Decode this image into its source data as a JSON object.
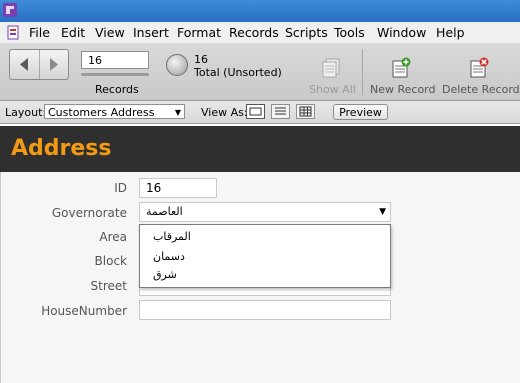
{
  "menu": {
    "items": [
      "File",
      "Edit",
      "View",
      "Insert",
      "Format",
      "Records",
      "Scripts",
      "Tools",
      "Window",
      "Help"
    ]
  },
  "toolbar": {
    "record_number": "16",
    "records_label": "Records",
    "found_count": "16",
    "found_status": "Total (Unsorted)",
    "show_all_label": "Show All",
    "new_record_label": "New Record",
    "delete_record_label": "Delete Record"
  },
  "layoutbar": {
    "layout_label": "Layout:",
    "layout_value": "Customers Address",
    "view_as_label": "View As:",
    "preview_label": "Preview"
  },
  "header": {
    "title": "Address"
  },
  "form": {
    "fields": [
      {
        "label": "ID",
        "value": "16"
      },
      {
        "label": "Governorate",
        "value": "العاصمة"
      },
      {
        "label": "Area",
        "value": ""
      },
      {
        "label": "Block",
        "value": ""
      },
      {
        "label": "Street",
        "value": ""
      },
      {
        "label": "HouseNumber",
        "value": ""
      }
    ]
  },
  "dropdown": {
    "options": [
      "المرقاب",
      "دسمان",
      "شرق"
    ]
  },
  "colors": {
    "header_bg": "#2f2f2f",
    "header_title": "#f39a14",
    "titlebar": "#2a6fc3"
  }
}
